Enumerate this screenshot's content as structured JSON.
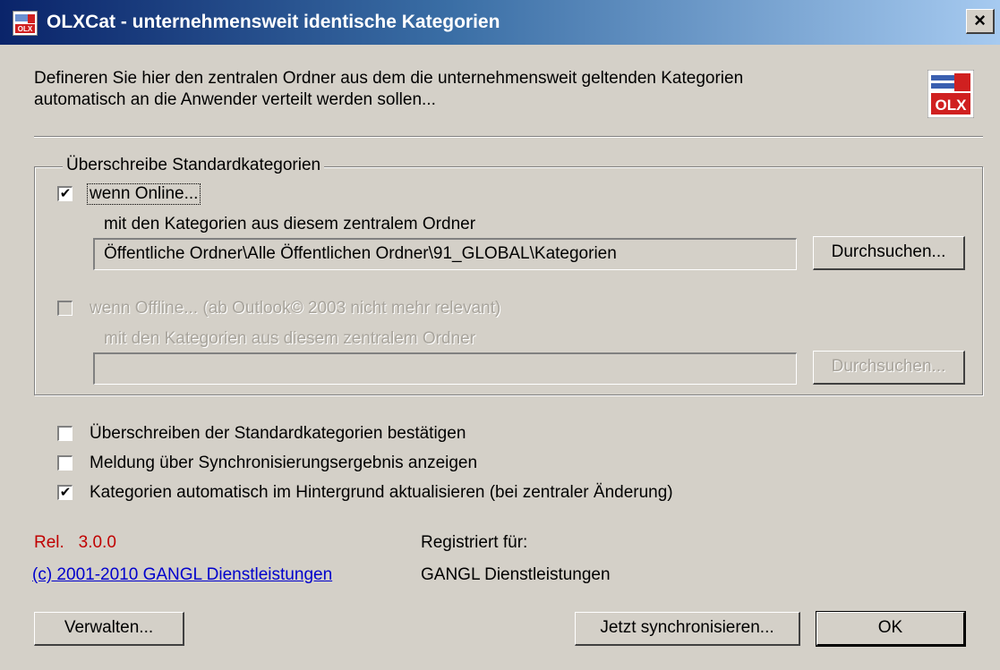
{
  "window": {
    "title": "OLXCat - unternehmensweit identische Kategorien",
    "close_label": "×"
  },
  "intro": {
    "line1": "Defineren Sie hier den zentralen Ordner aus dem die unternehmensweit geltenden Kategorien",
    "line2": "automatisch an die Anwender verteilt werden sollen..."
  },
  "group": {
    "legend": "Überschreibe Standardkategorien",
    "online": {
      "label": "wenn Online...",
      "checked": true,
      "check_mark": "✔",
      "sublabel": "mit den Kategorien aus diesem zentralem Ordner",
      "path": "Öffentliche Ordner\\Alle Öffentlichen Ordner\\91_GLOBAL\\Kategorien",
      "browse_label": "Durchsuchen..."
    },
    "offline": {
      "label": "wenn Offline...  (ab Outlook© 2003 nicht mehr relevant)",
      "checked": false,
      "sublabel": "mit den Kategorien aus diesem zentralem Ordner",
      "path": "",
      "browse_label": "Durchsuchen..."
    }
  },
  "options": [
    {
      "label": "Überschreiben der Standardkategorien bestätigen",
      "checked": false,
      "check_mark": ""
    },
    {
      "label": "Meldung über Synchronisierungsergebnis anzeigen",
      "checked": false,
      "check_mark": ""
    },
    {
      "label": "Kategorien automatisch im Hintergrund aktualisieren (bei zentraler Änderung)",
      "checked": true,
      "check_mark": "✔"
    }
  ],
  "footer": {
    "release_label": "Rel.",
    "release_version": "3.0.0",
    "copyright": "(c) 2001-2010 GANGL Dienstleistungen",
    "registered_label": "Registriert für:",
    "registered_to": "GANGL Dienstleistungen",
    "manage_label": "Verwalten...",
    "sync_label": "Jetzt synchronisieren...",
    "ok_label": "OK"
  },
  "colors": {
    "title_bar_start": "#0a246a",
    "title_bar_end": "#a6caf0",
    "release_text": "#c00000",
    "link_text": "#0000cc",
    "dialog_face": "#d4d0c8"
  },
  "icons": {
    "app": "olx-app-icon",
    "logo": "olx-logo"
  }
}
